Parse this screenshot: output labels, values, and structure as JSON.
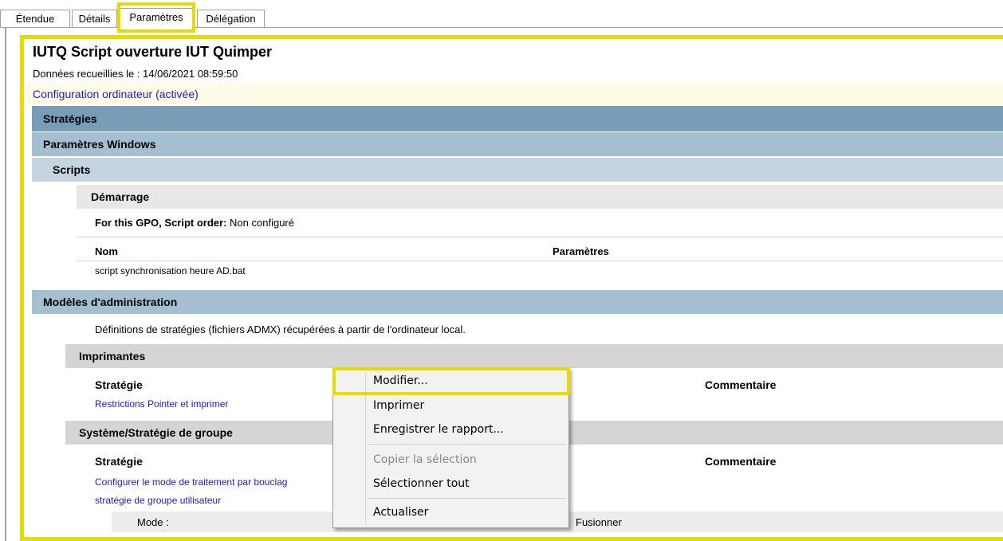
{
  "tabs": [
    "Étendue",
    "Détails",
    "Paramètres",
    "Délégation"
  ],
  "report": {
    "title": "IUTQ Script ouverture IUT Quimper",
    "collected": "Données recueillies le : 14/06/2021 08:59:50",
    "config_section": "Configuration ordinateur (activée)",
    "strategies": "Stratégies",
    "windows_settings": "Paramètres Windows",
    "scripts": "Scripts",
    "startup": "Démarrage",
    "script_order_label": "For this GPO, Script order:",
    "script_order_value": "Non configuré",
    "col_name": "Nom",
    "col_params": "Paramètres",
    "script_file": "script synchronisation heure AD.bat",
    "admin_templates": "Modèles d'administration",
    "admx_note": "Définitions de stratégies (fichiers ADMX) récupérées à partir de l'ordinateur local.",
    "printers": "Imprimantes",
    "col_policy": "Stratégie",
    "col_comment": "Commentaire",
    "printer_policy": "Restrictions Pointer et imprimer",
    "group_policy": "Système/Stratégie de groupe",
    "gp_policy_line1": "Configurer le mode de traitement par bouclag",
    "gp_policy_line2": "stratégie de groupe utilisateur",
    "mode_label": "Mode :",
    "mode_value": "Fusionner"
  },
  "context_menu": {
    "items": [
      "Modifier...",
      "Imprimer",
      "Enregistrer le rapport...",
      "Copier la sélection",
      "Sélectionner tout",
      "Actualiser"
    ]
  },
  "colors": {
    "highlight": "#e7dc00",
    "link": "#1d1ac4",
    "band_dark": "#789db7",
    "band_mid": "#a4bfd0"
  }
}
